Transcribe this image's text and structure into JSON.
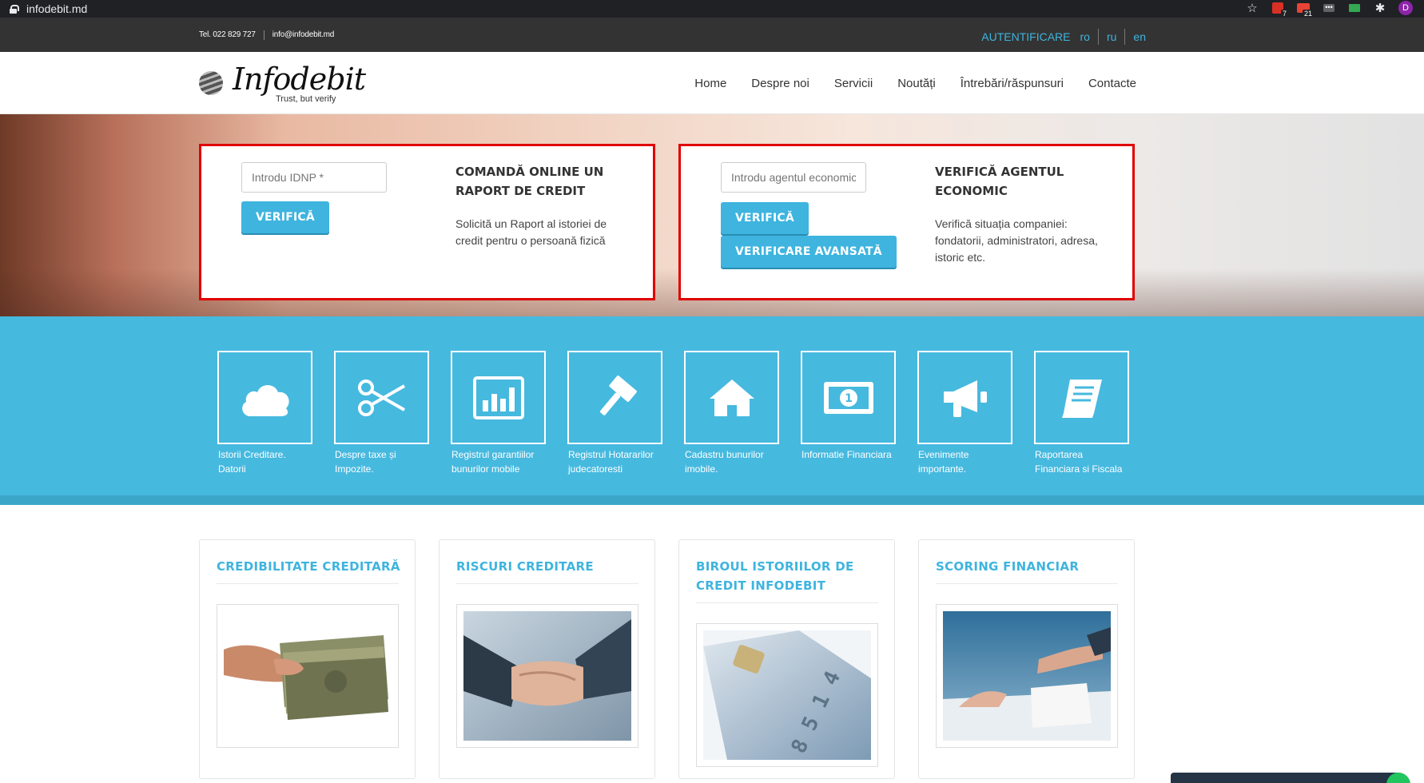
{
  "browser": {
    "url": "infodebit.md",
    "ext_badge_1": "7",
    "ext_badge_2": "21",
    "avatar_letter": "D"
  },
  "topbar": {
    "phone": "Tel. 022 829 727",
    "email": "info@infodebit.md",
    "login": "AUTENTIFICARE",
    "langs": [
      "ro",
      "ru",
      "en"
    ]
  },
  "header": {
    "logo_text": "Infodebit",
    "logo_tagline": "Trust, but verify",
    "nav": [
      "Home",
      "Despre noi",
      "Servicii",
      "Noutăți",
      "Întrebări/răspunsuri",
      "Contacte"
    ]
  },
  "hero": {
    "card1": {
      "placeholder": "Introdu IDNP *",
      "button": "VERIFICĂ",
      "title": "COMANDĂ ONLINE UN RAPORT DE CREDIT",
      "desc": "Solicită un Raport al istoriei de credit pentru o persoană fizică"
    },
    "card2": {
      "placeholder": "Introdu agentul economic",
      "button": "VERIFICĂ",
      "button2": "VERIFICARE AVANSATĂ",
      "title": "VERIFICĂ AGENTUL ECONOMIC",
      "desc": "Verifică situația companiei: fondatorii, administratori, adresa, istoric etc."
    }
  },
  "services": [
    {
      "icon": "cloud-icon",
      "label": "Istorii Creditare. Datorii"
    },
    {
      "icon": "scissors-icon",
      "label": "Despre taxe și Impozite."
    },
    {
      "icon": "bar-chart-icon",
      "label": "Registrul garantiilor bunurilor mobile"
    },
    {
      "icon": "gavel-icon",
      "label": "Registrul Hotararilor judecatoresti"
    },
    {
      "icon": "home-icon",
      "label": "Cadastru bunurilor imobile."
    },
    {
      "icon": "money-icon",
      "label": "Informatie Financiara"
    },
    {
      "icon": "megaphone-icon",
      "label": "Evenimente importante."
    },
    {
      "icon": "book-icon",
      "label": "Raportarea Financiara si Fiscala"
    }
  ],
  "articles": [
    {
      "title": "CREDIBILITATE CREDITARĂ"
    },
    {
      "title": "RISCURI CREDITARE"
    },
    {
      "title": "BIROUL ISTORIILOR DE CREDIT INFODEBIT"
    },
    {
      "title": "SCORING FINANCIAR"
    }
  ],
  "colors": {
    "accent": "#3eb4df",
    "strip": "#46b9df",
    "topbar": "#333333",
    "card_border": "#e00000"
  }
}
